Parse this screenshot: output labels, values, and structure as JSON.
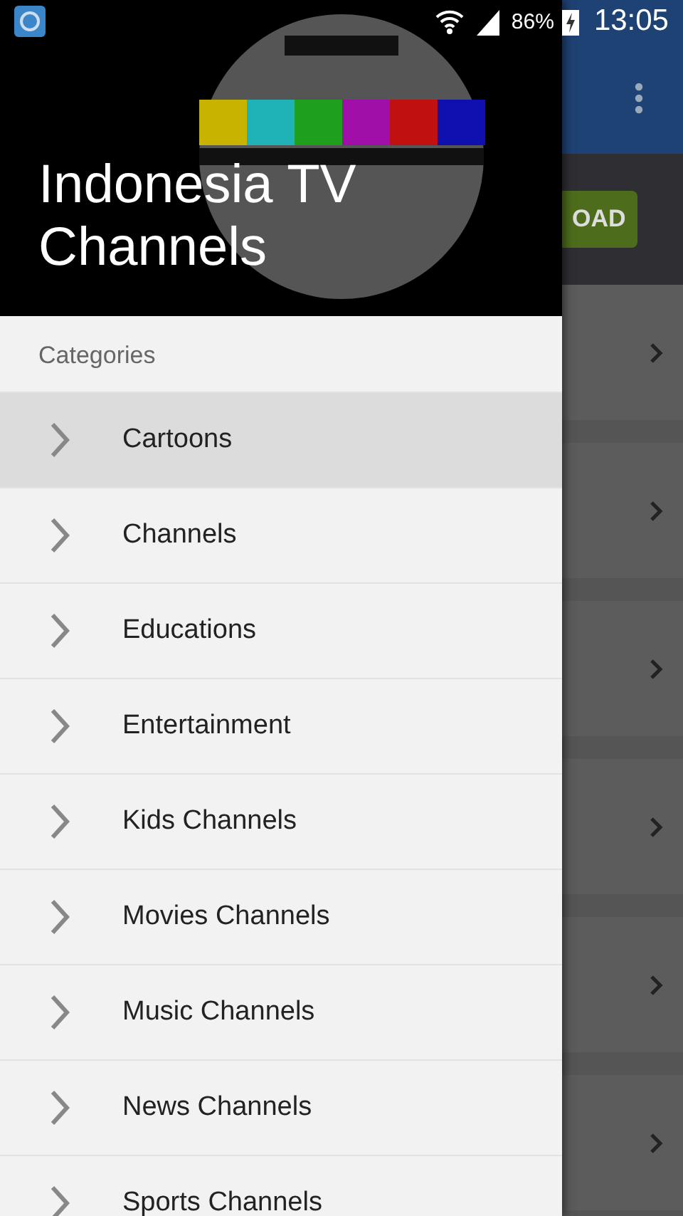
{
  "status_bar": {
    "battery": "86%",
    "time": "13:05"
  },
  "background_app": {
    "download_button": "OAD"
  },
  "drawer": {
    "title": "Indonesia TV Channels",
    "section_label": "Categories",
    "items": [
      {
        "label": "Cartoons",
        "selected": true
      },
      {
        "label": "Channels",
        "selected": false
      },
      {
        "label": "Educations",
        "selected": false
      },
      {
        "label": "Entertainment",
        "selected": false
      },
      {
        "label": "Kids Channels",
        "selected": false
      },
      {
        "label": "Movies Channels",
        "selected": false
      },
      {
        "label": "Music Channels",
        "selected": false
      },
      {
        "label": "News Channels",
        "selected": false
      },
      {
        "label": "Sports Channels",
        "selected": false
      }
    ]
  }
}
